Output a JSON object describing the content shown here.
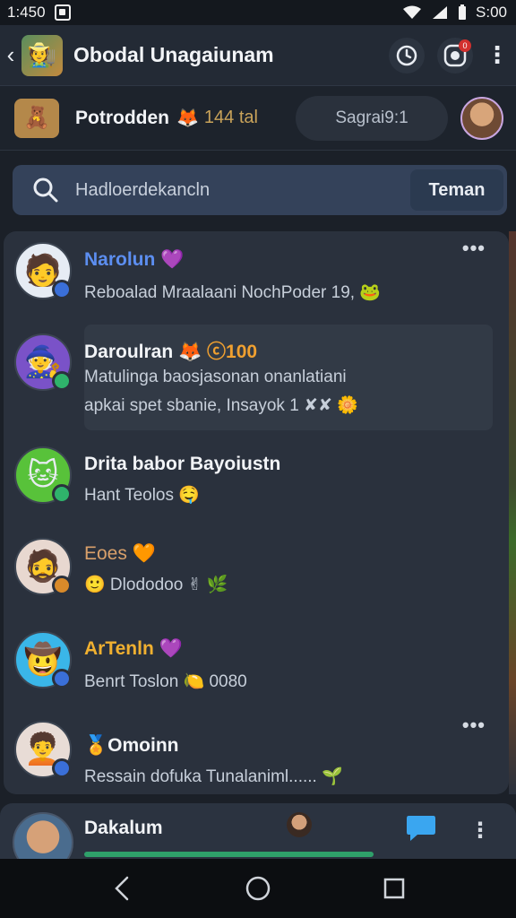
{
  "status_bar": {
    "time": "1:450",
    "right_time": "S:00"
  },
  "app_bar": {
    "title": "Obodal Unagaiunam",
    "icons": [
      "back-icon",
      "app-logo-icon",
      "clock-icon",
      "camera-icon",
      "more-vert-icon"
    ],
    "notification_count": "0"
  },
  "profile": {
    "name": "Potrodden",
    "count": "144 tal",
    "pill_label": "Sagrai9:1"
  },
  "search": {
    "placeholder": "Hadloerdekancln",
    "button_label": "Teman"
  },
  "chats": [
    {
      "name": "Narolun 💜",
      "message": "Reboalad Mraalaani NochPoder 19, 🐸",
      "avatar_emoji": "🧑",
      "avatar_bg": "#e6ecf4",
      "status_color": "#3a6fd8",
      "name_color": "#5c8ef0",
      "has_more": true
    },
    {
      "name": "Daroulran",
      "name_extra": "🦊 ⓒ100",
      "message_line1": "Matulinga baosjasonan onanlatiani",
      "message_line2": "apkai spet sbanie, Insayok 1 ✘✘ 🌼",
      "avatar_emoji": "🧙",
      "avatar_bg": "#7a52c8",
      "status_color": "#2fb36b",
      "name_color": "#f2f4f7",
      "has_more": false
    },
    {
      "name": "Drita babor Bayoiustn",
      "message": "Hant Teolos 🤤",
      "avatar_emoji": "🐱",
      "avatar_bg": "#58c23a",
      "status_color": "#2fb36b",
      "name_color": "#f2f4f7",
      "has_more": false
    },
    {
      "name": "Eoes 🧡",
      "message": "🙂 Dlododoo ✌ 🌿",
      "avatar_emoji": "🧔",
      "avatar_bg": "#e8d8d0",
      "status_color": "#d88a2a",
      "name_color": "#d9a06a",
      "has_more": false
    },
    {
      "name": "ArTenln 💜",
      "message": "Benrt Toslon 🍋 0080",
      "avatar_emoji": "🤠",
      "avatar_bg": "#3ab6e8",
      "status_color": "#3a6fd8",
      "name_color": "#f0b030",
      "has_more": false
    },
    {
      "name": "🏅Omoinn",
      "message": "Ressain dofuka Tunalaniml...... 🌱",
      "avatar_emoji": "🧑‍🦱",
      "avatar_bg": "#e8dcd6",
      "status_color": "#3a6fd8",
      "name_color": "#f2f4f7",
      "has_more": true
    }
  ],
  "bottom_chat": {
    "name": "Dakalum",
    "progress": 0.56
  },
  "nav": [
    "back-nav-icon",
    "home-nav-icon",
    "recents-nav-icon"
  ]
}
